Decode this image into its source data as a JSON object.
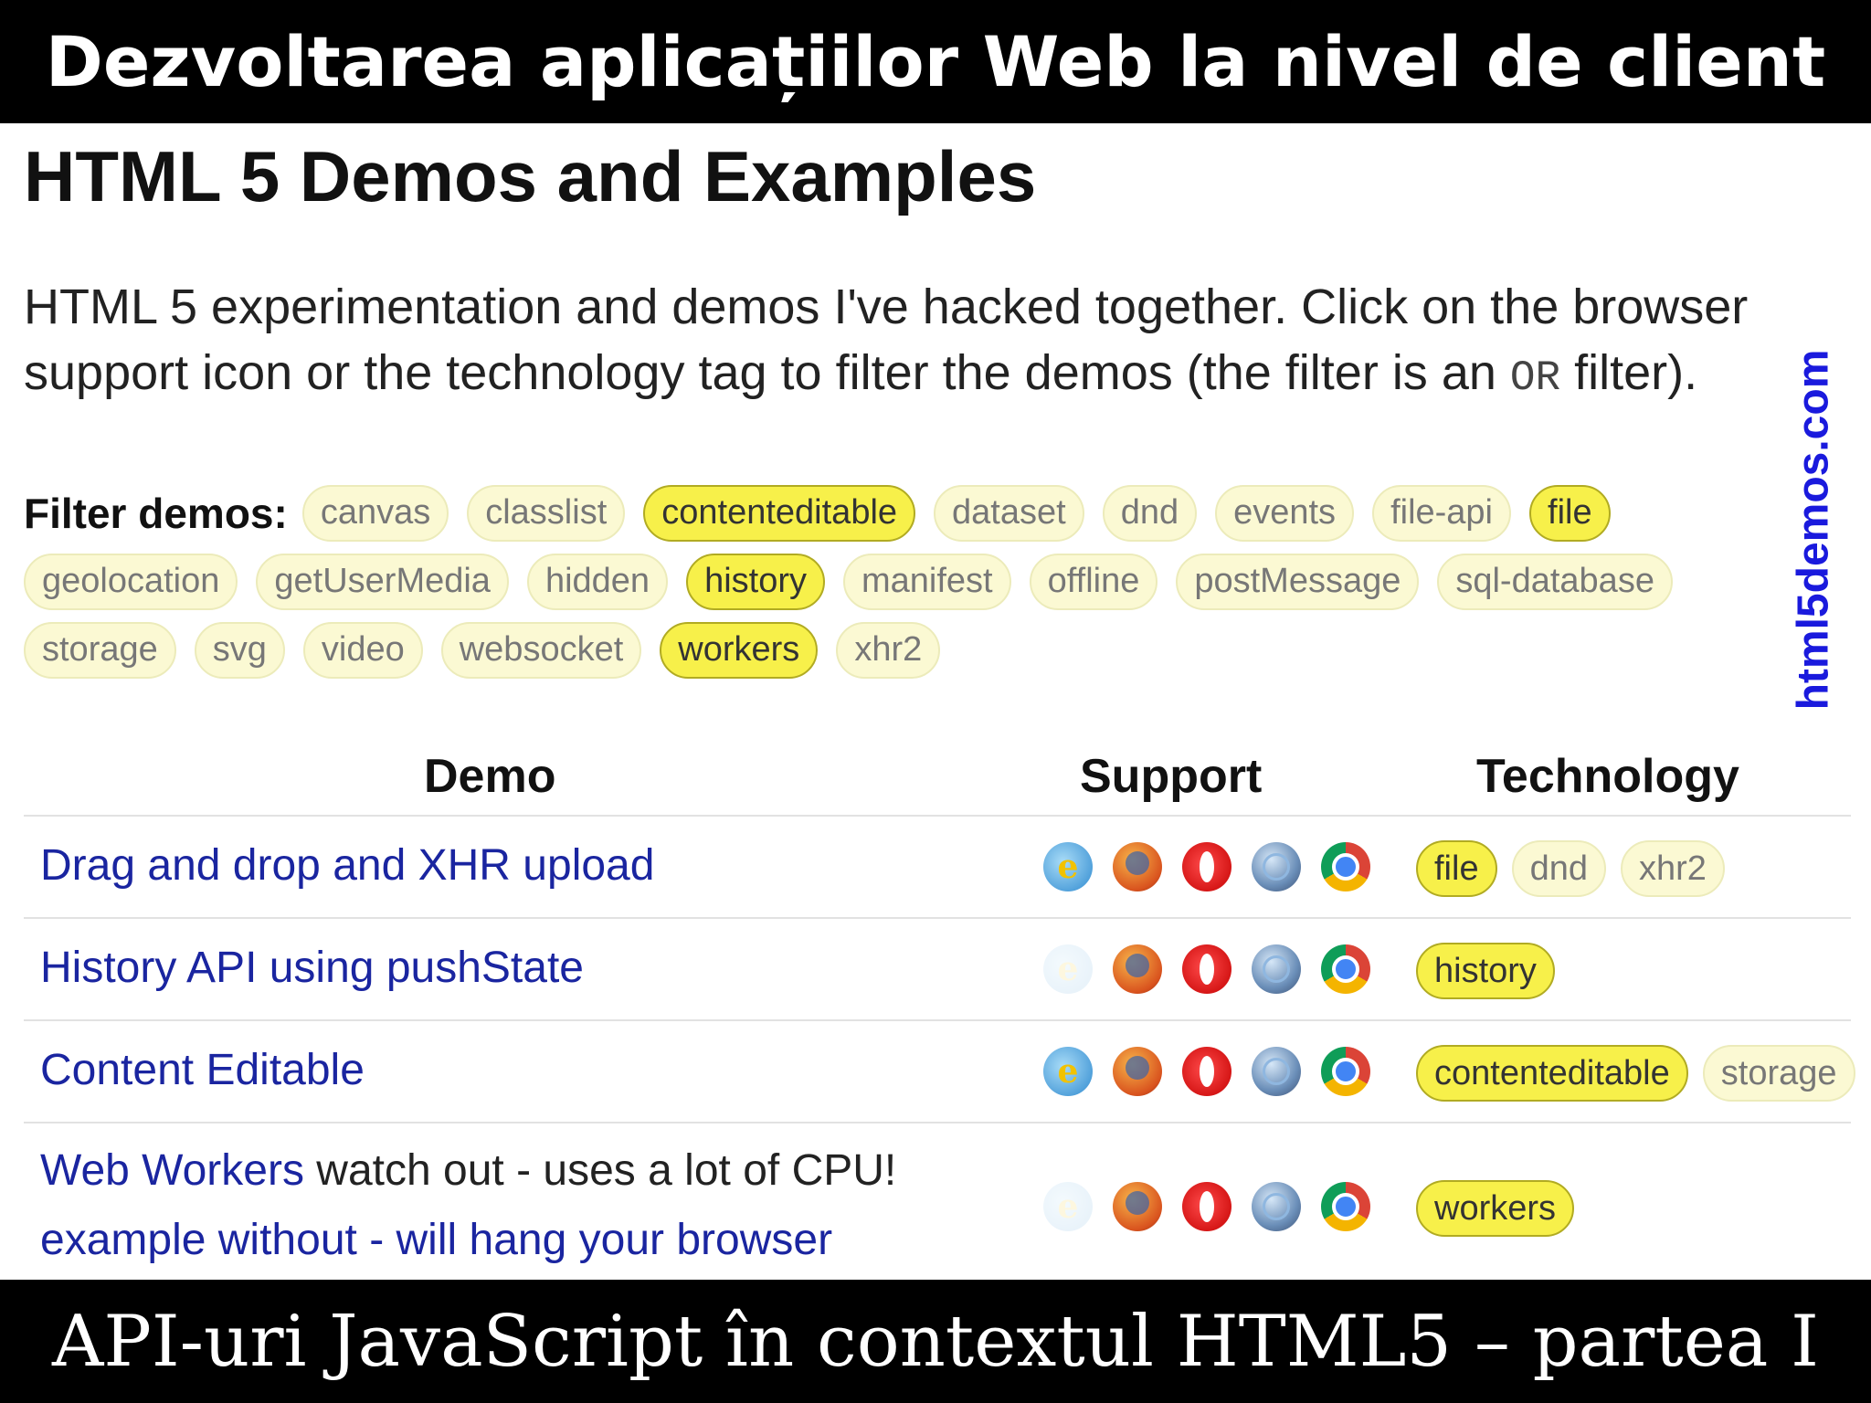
{
  "banner_top": "Dezvoltarea aplicațiilor Web la nivel de client",
  "banner_bottom": "API-uri JavaScript în contextul HTML5 – partea I",
  "side_url": "html5demos.com",
  "page": {
    "title": "HTML 5 Demos and Examples",
    "intro_before": "HTML 5 experimentation and demos I've hacked together. Click on the browser support icon or the technology tag to filter the demos (the filter is an ",
    "intro_code": "OR",
    "intro_after": " filter)."
  },
  "filter": {
    "label": "Filter demos:",
    "tags": [
      {
        "label": "canvas",
        "active": false
      },
      {
        "label": "classlist",
        "active": false
      },
      {
        "label": "contenteditable",
        "active": true
      },
      {
        "label": "dataset",
        "active": false
      },
      {
        "label": "dnd",
        "active": false
      },
      {
        "label": "events",
        "active": false
      },
      {
        "label": "file-api",
        "active": false
      },
      {
        "label": "file",
        "active": true
      },
      {
        "label": "geolocation",
        "active": false
      },
      {
        "label": "getUserMedia",
        "active": false
      },
      {
        "label": "hidden",
        "active": false
      },
      {
        "label": "history",
        "active": true
      },
      {
        "label": "manifest",
        "active": false
      },
      {
        "label": "offline",
        "active": false
      },
      {
        "label": "postMessage",
        "active": false
      },
      {
        "label": "sql-database",
        "active": false
      },
      {
        "label": "storage",
        "active": false
      },
      {
        "label": "svg",
        "active": false
      },
      {
        "label": "video",
        "active": false
      },
      {
        "label": "websocket",
        "active": false
      },
      {
        "label": "workers",
        "active": true
      },
      {
        "label": "xhr2",
        "active": false
      }
    ]
  },
  "table": {
    "headers": {
      "demo": "Demo",
      "support": "Support",
      "technology": "Technology"
    },
    "rows": [
      {
        "demo": "Drag and drop and XHR upload",
        "support_ie": "full",
        "techs": [
          {
            "label": "file",
            "active": true
          },
          {
            "label": "dnd",
            "active": false
          },
          {
            "label": "xhr2",
            "active": false
          }
        ]
      },
      {
        "demo": "History API using pushState",
        "support_ie": "none",
        "techs": [
          {
            "label": "history",
            "active": true
          }
        ]
      },
      {
        "demo": "Content Editable",
        "support_ie": "full",
        "techs": [
          {
            "label": "contenteditable",
            "active": true
          },
          {
            "label": "storage",
            "active": false
          }
        ]
      },
      {
        "demo": "Web Workers",
        "note": " watch out - uses a lot of CPU!",
        "demo_line2": "example without - will hang your browser",
        "support_ie": "none",
        "techs": [
          {
            "label": "workers",
            "active": true
          }
        ]
      }
    ]
  },
  "browser_icons": [
    "ie-icon",
    "firefox-icon",
    "opera-icon",
    "safari-icon",
    "chrome-icon"
  ]
}
